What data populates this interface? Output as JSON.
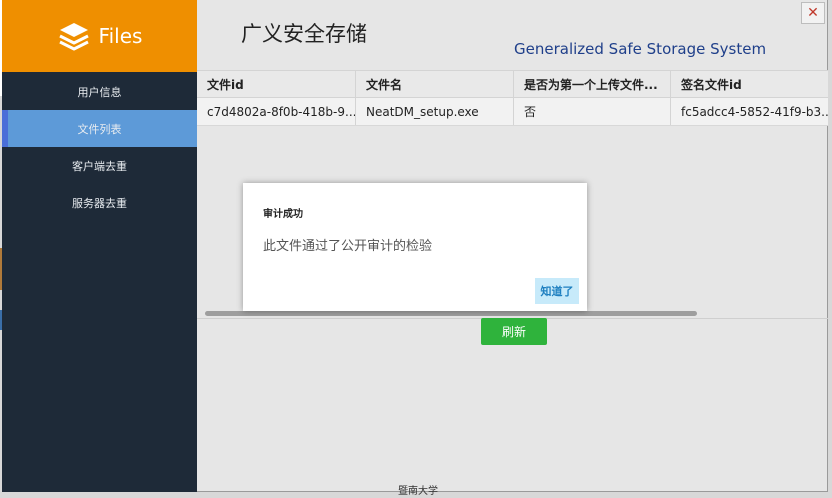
{
  "app": {
    "logo_text": "Files",
    "title": "广义安全存储",
    "subtitle": "Generalized Safe Storage System",
    "close_label": "✕"
  },
  "sidebar": {
    "items": [
      {
        "label": "用户信息",
        "active": false
      },
      {
        "label": "文件列表",
        "active": true
      },
      {
        "label": "客户端去重",
        "active": false
      },
      {
        "label": "服务器去重",
        "active": false
      }
    ]
  },
  "table": {
    "columns": [
      "文件id",
      "文件名",
      "是否为第一个上传文件...",
      "签名文件id"
    ],
    "rows": [
      [
        "c7d4802a-8f0b-418b-9...",
        "NeatDM_setup.exe",
        "否",
        "fc5adcc4-5852-41f9-b3..."
      ]
    ]
  },
  "refresh_label": "刷新",
  "footer_text": "暨南大学",
  "dialog": {
    "title": "审计成功",
    "message": "此文件通过了公开审计的检验",
    "ok_label": "知道了"
  },
  "colors": {
    "sidebar_bg": "#1e2a38",
    "logo_bg": "#ef8f00",
    "active_item": "#5d9ad8",
    "refresh_btn": "#2fb33c",
    "dialog_btn": "#c7eafa"
  }
}
